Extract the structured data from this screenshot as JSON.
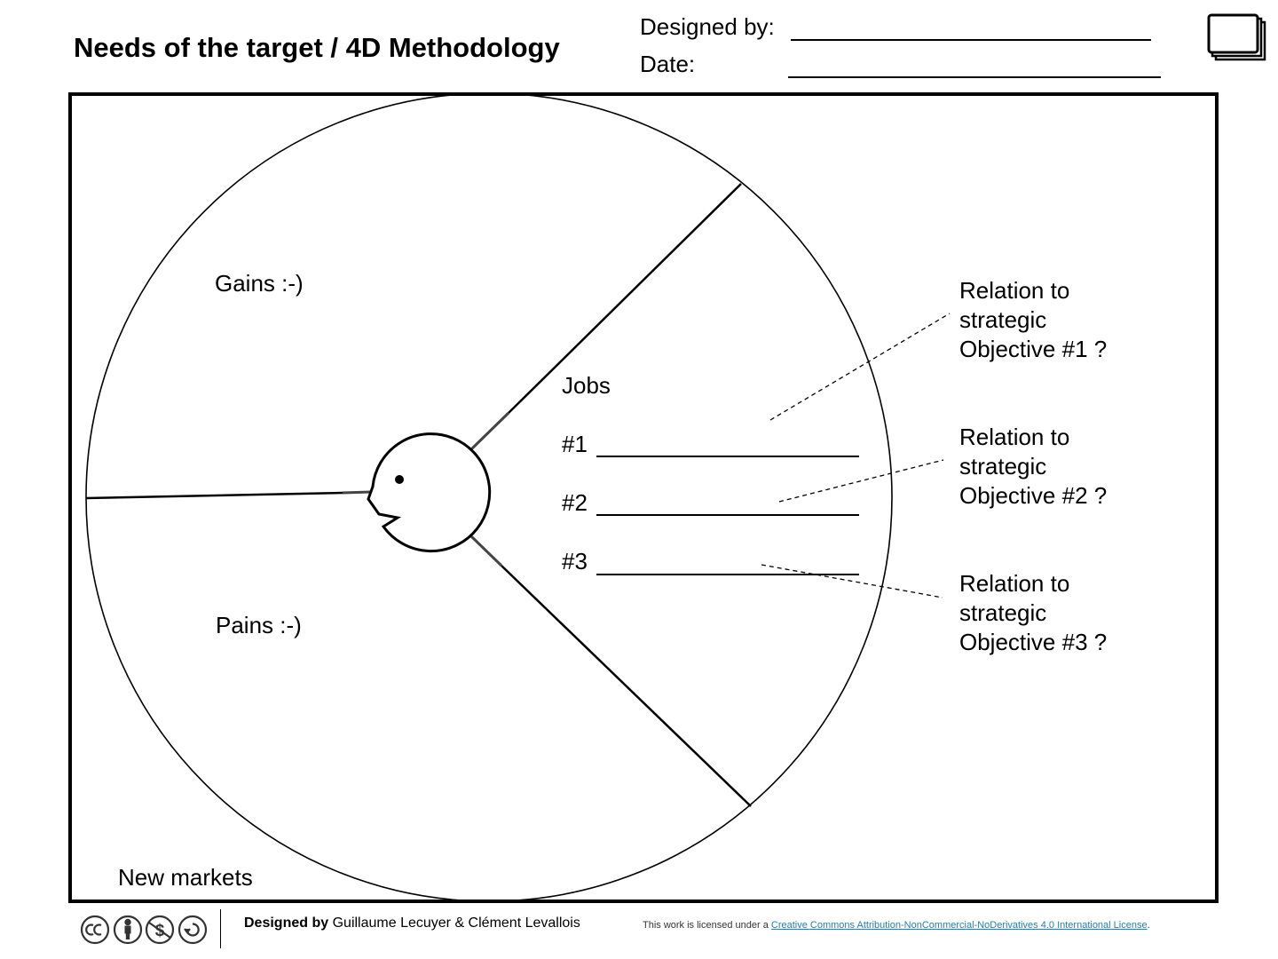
{
  "header": {
    "title": "Needs of the target / 4D Methodology",
    "designed_by_label": "Designed by:",
    "date_label": "Date:"
  },
  "canvas": {
    "gains_label": "Gains :-)",
    "pains_label": "Pains :-)",
    "jobs_label": "Jobs",
    "jobs": [
      "#1",
      "#2",
      "#3"
    ],
    "relations": [
      {
        "line1": "Relation to",
        "line2": "strategic",
        "line3": "Objective #1 ?"
      },
      {
        "line1": "Relation to",
        "line2": "strategic",
        "line3": "Objective #2 ?"
      },
      {
        "line1": "Relation to",
        "line2": "strategic",
        "line3": "Objective #3 ?"
      }
    ],
    "corner_label": "New markets"
  },
  "footer": {
    "designed_by_prefix": "Designed by",
    "authors": "Guillaume Lecuyer & Clément Levallois",
    "license_prefix": "This work is licensed under a ",
    "license_link": "Creative Commons Attribution-NonCommercial-NoDerivatives 4.0 International License",
    "license_suffix": ".",
    "license_icons": [
      "cc-icon",
      "by-icon",
      "nc-icon",
      "nd-icon"
    ]
  }
}
